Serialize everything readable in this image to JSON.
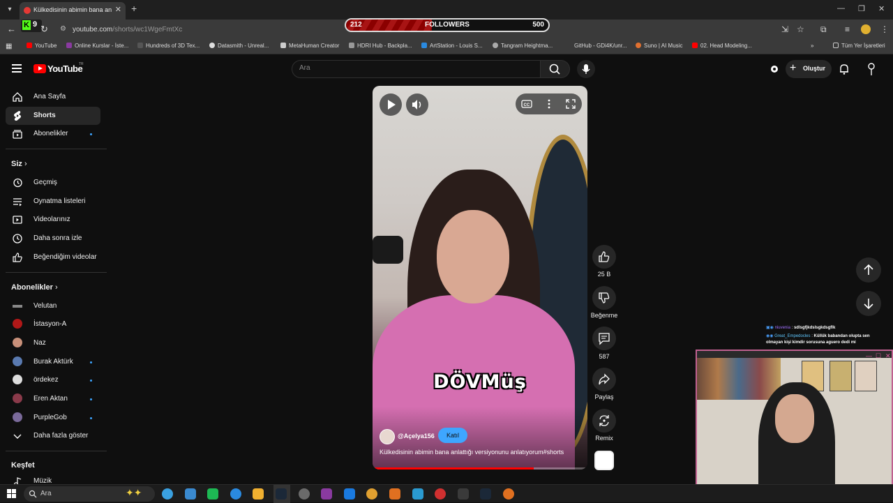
{
  "browser": {
    "tab_title": "Külkedisinin abimin bana anlattı",
    "url_host": "youtube.com",
    "url_path": "/shorts/wc1WgeFmtXc",
    "kick_badge_count": "9",
    "bookmarks": [
      "YouTube",
      "Online Kurslar - İste...",
      "Hundreds of 3D Tex...",
      "Datasmith - Unreal...",
      "MetaHuman Creator",
      "HDRI Hub - Backpla...",
      "ArtStation - Louis S...",
      "Tangram Heightma...",
      "GitHub - GDi4K/unr...",
      "Suno | AI Music",
      "02. Head Modeling...",
      "Tüm Yer İşaretleri"
    ]
  },
  "followers_overlay": {
    "current": "212",
    "label": "FOLLOWERS",
    "goal": "500",
    "progress": 0.424
  },
  "youtube": {
    "logo_text": "YouTube",
    "logo_region": "TR",
    "search_placeholder": "Ara",
    "create_label": "Oluştur",
    "sidebar": {
      "main": [
        {
          "label": "Ana Sayfa"
        },
        {
          "label": "Shorts"
        },
        {
          "label": "Abonelikler"
        }
      ],
      "you_header": "Siz",
      "you": [
        {
          "label": "Geçmiş"
        },
        {
          "label": "Oynatma listeleri"
        },
        {
          "label": "Videolarınız"
        },
        {
          "label": "Daha sonra izle"
        },
        {
          "label": "Beğendiğim videolar"
        }
      ],
      "subs_header": "Abonelikler",
      "subs": [
        {
          "label": "Velutan",
          "color": "#888888"
        },
        {
          "label": "İstasyon-A",
          "color": "#b01818"
        },
        {
          "label": "Naz",
          "color": "#c8907a"
        },
        {
          "label": "Burak Aktürk",
          "color": "#5a7ab0"
        },
        {
          "label": "ördekez",
          "color": "#dddddd"
        },
        {
          "label": "Eren Aktan",
          "color": "#8a3a4a"
        },
        {
          "label": "PurpleGob",
          "color": "#7a6a9a"
        }
      ],
      "show_more": "Daha fazla göster",
      "explore_header": "Keşfet",
      "explore": [
        {
          "label": "Müzik"
        }
      ]
    },
    "short": {
      "caption": "DÖVMüş",
      "channel": "@Açelya156",
      "join_label": "Katıl",
      "description": "Külkedisinin abimin bana anlattığı versiyonunu anlatıyorum#shorts",
      "progress": 0.75
    },
    "actions": {
      "likes": "25 B",
      "dislike_label": "Beğenme",
      "comments": "587",
      "share_label": "Paylaş",
      "remix_label": "Remix"
    }
  },
  "chat": [
    {
      "user": "niuvenia",
      "message": "sdlsgfjkdslsgkdsgflk",
      "color": "#a070ff"
    },
    {
      "user": "Great_Empedocles",
      "message": "Küllük babandan olupta sen olmayan kişi kimdir sorusuna aguero dedi mi",
      "color": "#60c8ff"
    }
  ],
  "taskbar": {
    "search_placeholder": "Ara",
    "icon_colors": [
      "#3aa0e0",
      "#3a8ad0",
      "#1db954",
      "#2a8ae0",
      "#f0b030",
      "#1b2838",
      "#6a6a6a",
      "#8a3aa0",
      "#1a7ae0",
      "#e0a030",
      "#e07020",
      "#2a9ad0",
      "#d03030",
      "#3a3a3a",
      "#1b2838",
      "#e07020"
    ]
  }
}
